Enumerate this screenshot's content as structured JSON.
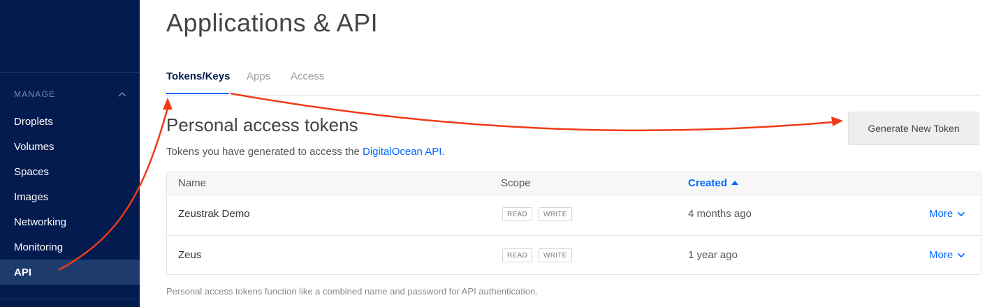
{
  "sidebar": {
    "section_label": "MANAGE",
    "items": [
      {
        "label": "Droplets"
      },
      {
        "label": "Volumes"
      },
      {
        "label": "Spaces"
      },
      {
        "label": "Images"
      },
      {
        "label": "Networking"
      },
      {
        "label": "Monitoring"
      },
      {
        "label": "API",
        "active": true
      }
    ]
  },
  "page": {
    "title": "Applications & API"
  },
  "tabs": [
    {
      "label": "Tokens/Keys",
      "active": true
    },
    {
      "label": "Apps"
    },
    {
      "label": "Access"
    }
  ],
  "tokens_section": {
    "title": "Personal access tokens",
    "description_prefix": "Tokens you have generated to access the ",
    "description_link": "DigitalOcean API",
    "description_suffix": ".",
    "generate_button": "Generate New Token",
    "footnote": "Personal access tokens function like a combined name and password for API authentication."
  },
  "table": {
    "columns": {
      "name": "Name",
      "scope": "Scope",
      "created": "Created"
    },
    "rows": [
      {
        "name": "Zeustrak Demo",
        "scope_read": "READ",
        "scope_write": "WRITE",
        "created": "4 months ago",
        "action": "More"
      },
      {
        "name": "Zeus",
        "scope_read": "READ",
        "scope_write": "WRITE",
        "created": "1 year ago",
        "action": "More"
      }
    ]
  },
  "colors": {
    "sidebar_bg": "#031b4e",
    "sidebar_active": "#1d3b6d",
    "accent": "#0069ff",
    "annotation_arrow": "#f03a17"
  }
}
